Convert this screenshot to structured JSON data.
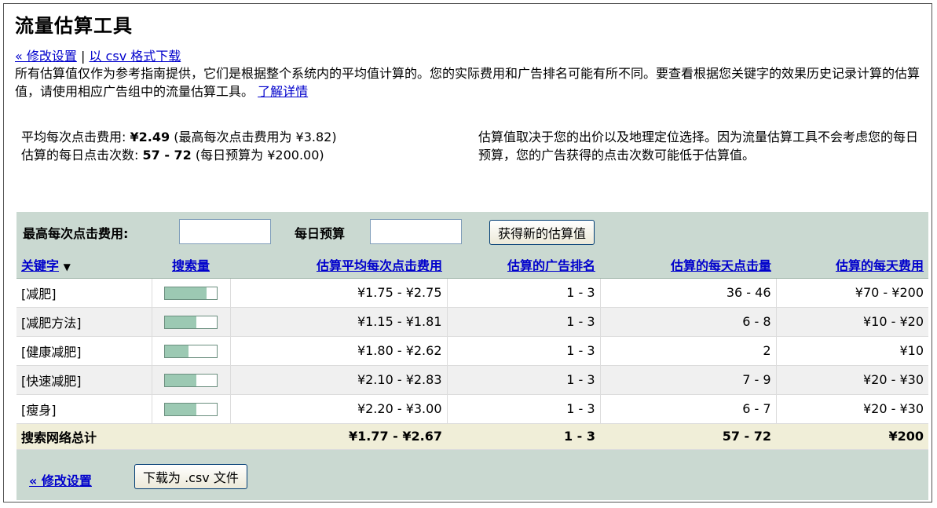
{
  "title": "流量估算工具",
  "top_links": {
    "modify": "« 修改设置",
    "separator": "|",
    "csv": "以 csv 格式下载"
  },
  "intro": {
    "text": "所有估算值仅作为参考指南提供，它们是根据整个系统内的平均值计算的。您的实际费用和广告排名可能有所不同。要查看根据您关键字的效果历史记录计算的估算值，请使用相应广告组中的流量估算工具。",
    "learn_more": "了解详情"
  },
  "stats": {
    "avg_cpc_label": "平均每次点击费用:",
    "avg_cpc_value": "¥2.49",
    "avg_cpc_note": "(最高每次点击费用为 ¥3.82)",
    "daily_clicks_label": "估算的每日点击次数:",
    "daily_clicks_value": "57 - 72",
    "daily_clicks_note": "(每日预算为 ¥200.00)"
  },
  "note": "估算值取决于您的出价以及地理定位选择。因为流量估算工具不会考虑您的每日预算，您的广告获得的点击次数可能低于估算值。",
  "controls": {
    "max_cpc_label": "最高每次点击费用:",
    "max_cpc_value": "",
    "daily_budget_label": "每日预算",
    "daily_budget_value": "",
    "get_estimates_button": "获得新的估算值"
  },
  "table": {
    "headers": {
      "keyword": "关键字",
      "sort_arrow": "▼",
      "search_volume": "搜索量",
      "avg_cpc": "估算平均每次点击费用",
      "position": "估算的广告排名",
      "clicks_per_day": "估算的每天点击量",
      "cost_per_day": "估算的每天费用"
    },
    "rows": [
      {
        "keyword": "[减肥]",
        "volume": 0.8,
        "avg_cpc": "¥1.75 - ¥2.75",
        "position": "1 - 3",
        "clicks": "36 - 46",
        "cost": "¥70 - ¥200"
      },
      {
        "keyword": "[减肥方法]",
        "volume": 0.6,
        "avg_cpc": "¥1.15 - ¥1.81",
        "position": "1 - 3",
        "clicks": "6 - 8",
        "cost": "¥10 - ¥20"
      },
      {
        "keyword": "[健康减肥]",
        "volume": 0.45,
        "avg_cpc": "¥1.80 - ¥2.62",
        "position": "1 - 3",
        "clicks": "2",
        "cost": "¥10"
      },
      {
        "keyword": "[快速减肥]",
        "volume": 0.6,
        "avg_cpc": "¥2.10 - ¥2.83",
        "position": "1 - 3",
        "clicks": "7 - 9",
        "cost": "¥20 - ¥30"
      },
      {
        "keyword": "[瘦身]",
        "volume": 0.6,
        "avg_cpc": "¥2.20 - ¥3.00",
        "position": "1 - 3",
        "clicks": "6 - 7",
        "cost": "¥20 - ¥30"
      }
    ],
    "total": {
      "label": "搜索网络总计",
      "avg_cpc": "¥1.77 - ¥2.67",
      "position": "1 - 3",
      "clicks": "57 - 72",
      "cost": "¥200"
    }
  },
  "footer": {
    "modify": "« 修改设置",
    "download_button": "下载为 .csv 文件"
  },
  "colors": {
    "panel_bg": "#cad9d1",
    "link": "#0000cc",
    "bar_fill": "#9cc9b3",
    "total_row_bg": "#f0eed8"
  }
}
